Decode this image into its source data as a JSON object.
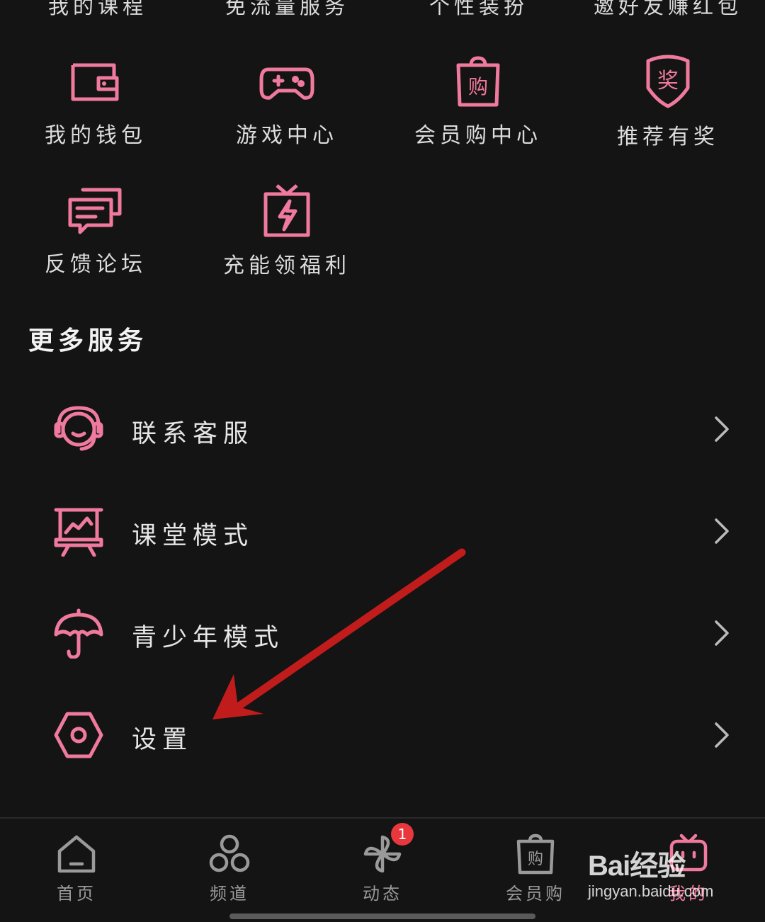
{
  "top_row_cut": [
    "我的课程",
    "免流量服务",
    "个性装扮",
    "邀好友赚红包"
  ],
  "grid": [
    {
      "label": "我的钱包",
      "icon": "wallet-icon"
    },
    {
      "label": "游戏中心",
      "icon": "gamepad-icon"
    },
    {
      "label": "会员购中心",
      "icon": "shopping-bag-icon"
    },
    {
      "label": "推荐有奖",
      "icon": "reward-badge-icon",
      "icon_text": "奖"
    },
    {
      "label": "反馈论坛",
      "icon": "chat-bubbles-icon"
    },
    {
      "label": "充能领福利",
      "icon": "gift-lightning-icon"
    }
  ],
  "more_services": {
    "title": "更多服务",
    "items": [
      {
        "label": "联系客服",
        "icon": "headset-icon"
      },
      {
        "label": "课堂模式",
        "icon": "presentation-board-icon"
      },
      {
        "label": "青少年模式",
        "icon": "umbrella-icon"
      },
      {
        "label": "设置",
        "icon": "settings-hexagon-icon"
      }
    ]
  },
  "tabbar": {
    "items": [
      {
        "label": "首页",
        "icon": "home-icon"
      },
      {
        "label": "频道",
        "icon": "channel-circles-icon"
      },
      {
        "label": "动态",
        "icon": "pinwheel-icon",
        "badge": "1"
      },
      {
        "label": "会员购",
        "icon": "shopping-bag-icon"
      },
      {
        "label": "我的",
        "icon": "tv-icon",
        "active": true
      }
    ]
  },
  "watermark": {
    "line1": "Bai经验",
    "line2": "jingyan.baidu.com"
  },
  "colors": {
    "background": "#141414",
    "accent": "#f07a9e",
    "badge": "#e8383d",
    "arrow": "#c01c1c"
  }
}
